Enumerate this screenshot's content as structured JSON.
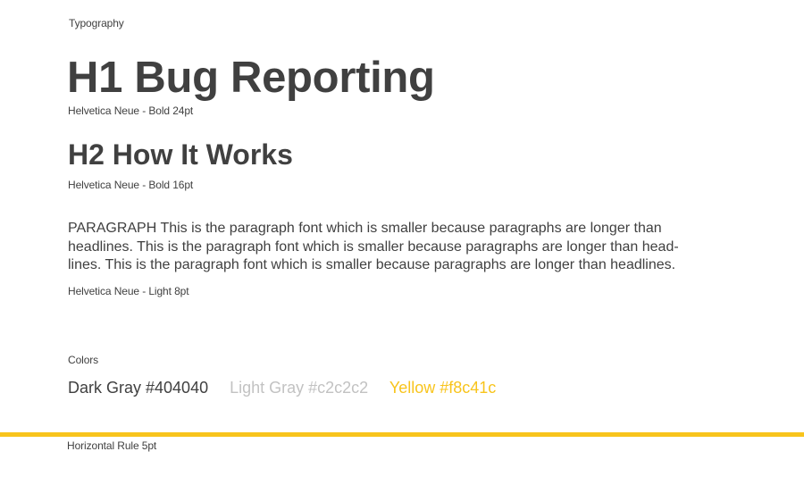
{
  "section_typography": "Typography",
  "h1": {
    "text": "H1 Bug Reporting",
    "spec": "Helvetica Neue - Bold 24pt"
  },
  "h2": {
    "text": "H2 How It Works",
    "spec": "Helvetica Neue - Bold 16pt"
  },
  "paragraph": {
    "lines": [
      "PARAGRAPH This is the paragraph font which is smaller because paragraphs are longer than",
      "headlines.  This is the paragraph font which is smaller because paragraphs are longer than head-",
      "lines.  This is the paragraph font which is smaller because paragraphs are longer than headlines."
    ],
    "spec": "Helvetica Neue - Light 8pt"
  },
  "section_colors": "Colors",
  "colors": [
    {
      "label": "Dark Gray #404040",
      "hex": "#404040"
    },
    {
      "label": "Light Gray #c2c2c2",
      "hex": "#c2c2c2"
    },
    {
      "label": "Yellow #f8c41c",
      "hex": "#f8c41c"
    }
  ],
  "rule": {
    "label": "Horizontal Rule 5pt",
    "color": "#f8c41c"
  }
}
